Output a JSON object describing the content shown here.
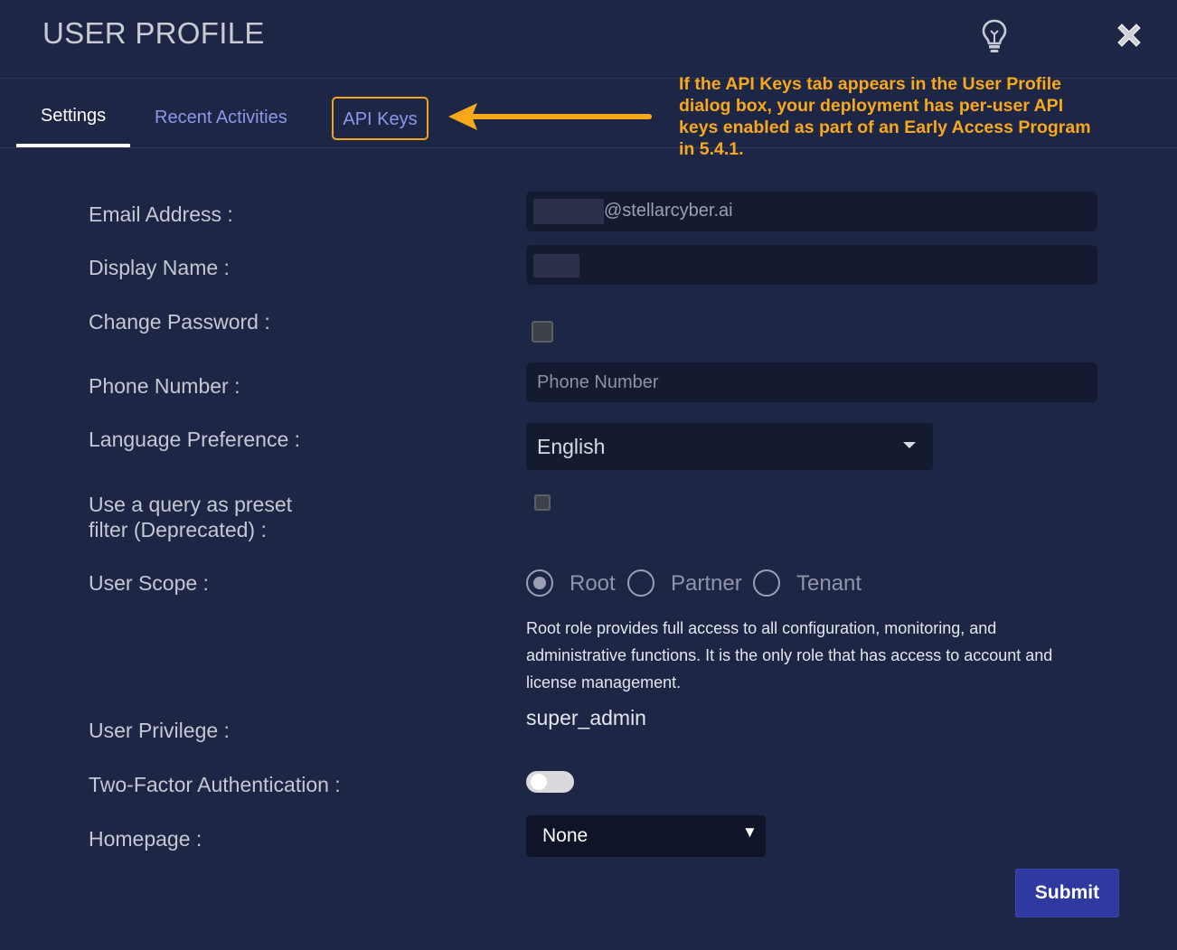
{
  "header": {
    "title": "USER PROFILE",
    "hint_icon": "lightbulb-icon",
    "close_icon": "close-icon"
  },
  "tabs": [
    {
      "label": "Settings",
      "active": true
    },
    {
      "label": "Recent Activities",
      "active": false
    },
    {
      "label": "API Keys",
      "active": false
    }
  ],
  "callout": {
    "text": "If the API Keys tab appears in the User Profile dialog box, your deployment has per-user API keys enabled as part of an Early Access Program in 5.4.1.",
    "color": "#f7a81b"
  },
  "form": {
    "email": {
      "label": "Email Address :",
      "value": "@stellarcyber.ai"
    },
    "display_name": {
      "label": "Display Name :",
      "value": ""
    },
    "change_password": {
      "label": "Change Password :",
      "checked": false
    },
    "phone": {
      "label": "Phone Number :",
      "placeholder": "Phone Number",
      "value": ""
    },
    "language": {
      "label": "Language Preference :",
      "value": "English"
    },
    "preset_filter": {
      "label_line1": "Use a query as preset",
      "label_line2": "filter (Deprecated) :",
      "checked": false
    },
    "user_scope": {
      "label": "User Scope :",
      "options": [
        "Root",
        "Partner",
        "Tenant"
      ],
      "selected": "Root",
      "description": "Root role provides full access to all configuration, monitoring, and administrative functions. It is the only role that has access to account and license management."
    },
    "user_privilege": {
      "label": "User Privilege :",
      "value": "super_admin"
    },
    "two_factor": {
      "label": "Two-Factor Authentication :",
      "enabled": false
    },
    "homepage": {
      "label": "Homepage :",
      "value": "None"
    }
  },
  "submit_label": "Submit",
  "colors": {
    "background": "#1e2645",
    "field_bg": "#141a30",
    "accent": "#8f96e8",
    "submit_bg": "#2e3a9f",
    "callout": "#f7a81b"
  }
}
